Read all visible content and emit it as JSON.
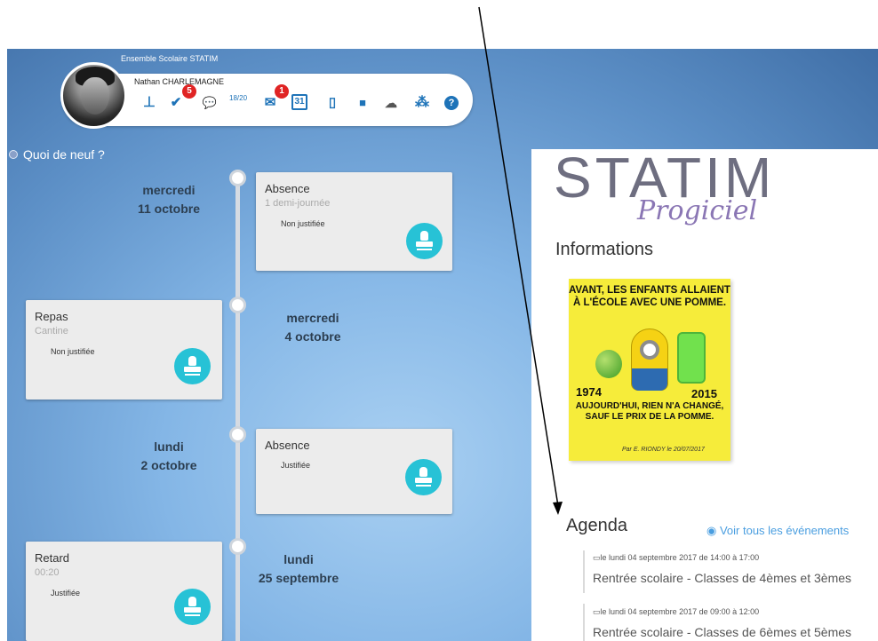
{
  "header": {
    "school_name": "Ensemble Scolaire STATIM",
    "user_name": "Nathan CHARLEMAGNE"
  },
  "toolbar": {
    "icons": [
      {
        "name": "grades-icon",
        "glyph": "⊥"
      },
      {
        "name": "homework-icon",
        "glyph": "✔",
        "badge": "5"
      },
      {
        "name": "chat-icon",
        "glyph": "💬"
      },
      {
        "name": "marks-icon",
        "glyph": "18/20"
      },
      {
        "name": "mail-icon",
        "glyph": "✉",
        "badge": "1"
      },
      {
        "name": "calendar-icon",
        "glyph": "31"
      },
      {
        "name": "notebook-icon",
        "glyph": "▯"
      },
      {
        "name": "folder-icon",
        "glyph": "■"
      },
      {
        "name": "cloud-icon",
        "glyph": "☁"
      },
      {
        "name": "network-icon",
        "glyph": "⁂"
      },
      {
        "name": "help-icon",
        "glyph": "?"
      }
    ]
  },
  "feed": {
    "title": "Quoi de neuf ?",
    "events": [
      {
        "day": "mercredi",
        "date": "11 octobre",
        "title": "Absence",
        "sub": "1 demi-journée",
        "status": "Non justifiée"
      },
      {
        "day": "mercredi",
        "date": "4 octobre",
        "title": "Repas",
        "sub": "Cantine",
        "status": "Non justifiée"
      },
      {
        "day": "lundi",
        "date": "2 octobre",
        "title": "Absence",
        "sub": "",
        "status": "Justifiée"
      },
      {
        "day": "lundi",
        "date": "25 septembre",
        "title": "Retard",
        "sub": "00:20",
        "status": "Justifiée"
      }
    ]
  },
  "logo": {
    "main": "STATIM",
    "sub": "Progiciel"
  },
  "informations": {
    "title": "Informations",
    "meme": {
      "top": "AVANT, LES ENFANTS ALLAIENT À L'ÉCOLE AVEC UNE POMME.",
      "year1": "1974",
      "year2": "2015",
      "bottom": "AUJOURD'HUI, RIEN N'A CHANGÉ, SAUF LE PRIX DE LA POMME.",
      "credit": "Par E. RIONDY le 20/07/2017"
    }
  },
  "agenda": {
    "title": "Agenda",
    "link": "Voir tous les événements",
    "events": [
      {
        "date": "le lundi 04 septembre 2017 de 14:00 à 17:00",
        "title": "Rentrée scolaire - Classes de 4èmes et 3èmes"
      },
      {
        "date": "le lundi 04 septembre 2017 de 09:00 à 12:00",
        "title": "Rentrée scolaire - Classes de 6èmes et 5èmes"
      }
    ]
  },
  "colors": {
    "accent": "#27c2d6",
    "badge": "#e02424",
    "icon": "#1e73b8"
  }
}
